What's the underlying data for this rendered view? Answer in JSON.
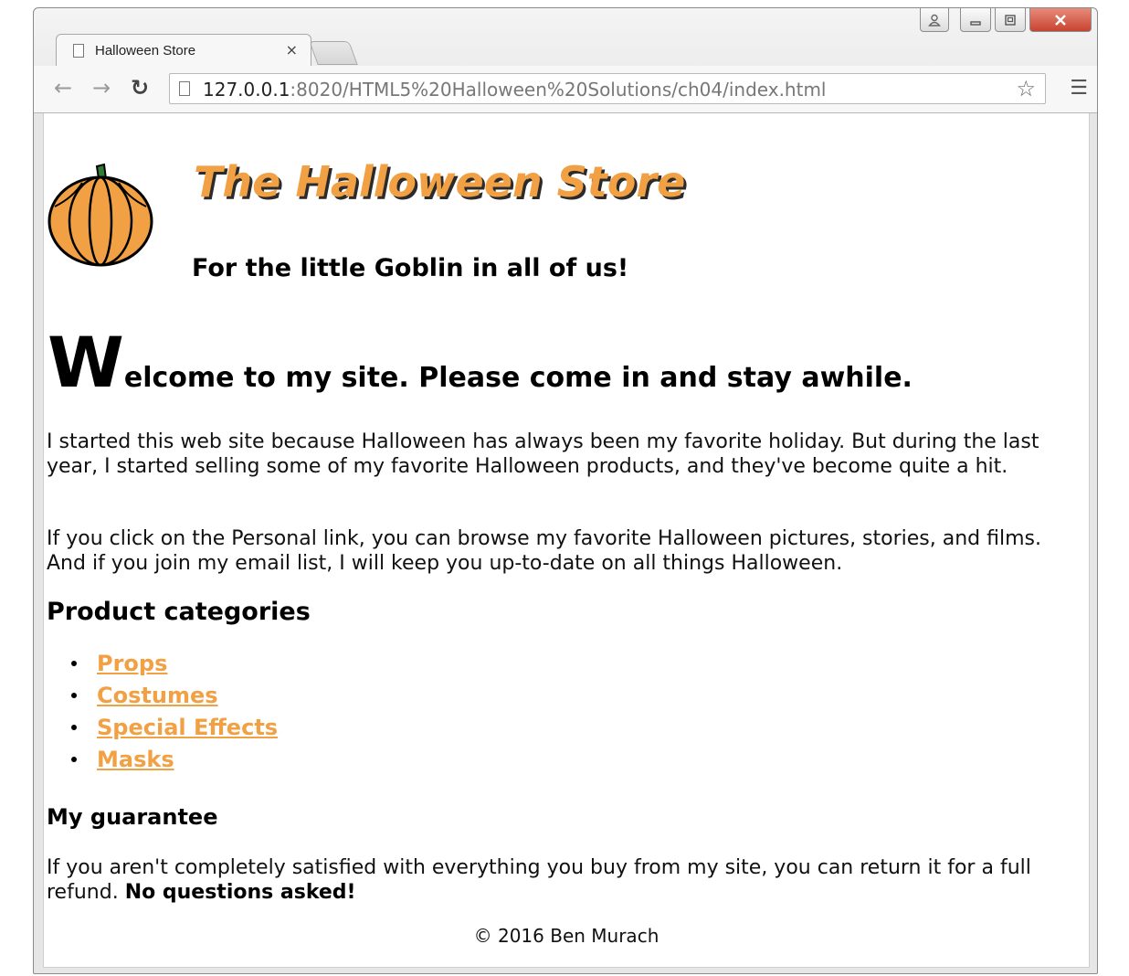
{
  "browser": {
    "tab_title": "Halloween Store",
    "tab_close": "×",
    "url_host": "127.0.0.1",
    "url_path": ":8020/HTML5%20Halloween%20Solutions/ch04/index.html",
    "icons": {
      "back": "back-arrow-icon",
      "forward": "forward-arrow-icon",
      "reload": "reload-icon",
      "bookmark": "star-icon",
      "menu": "hamburger-menu-icon",
      "profile": "profile-icon",
      "minimize": "minimize-icon",
      "maximize": "maximize-icon",
      "close": "close-icon"
    }
  },
  "page": {
    "store_title": "The Halloween Store",
    "tagline": "For the little Goblin in all of us!",
    "welcome_dropcap": "W",
    "welcome_rest": "elcome to my site. Please come in and stay awhile.",
    "intro_1": "I started this web site because Halloween has always been my favorite holiday. But during the last year, I started selling some of my favorite Halloween products, and they've become quite a hit.",
    "intro_2": "If you click on the Personal link, you can browse my favorite Halloween pictures, stories, and films. And if you join my email list, I will keep you up-to-date on all things Halloween.",
    "categories_heading": "Product categories",
    "categories": [
      {
        "label": "Props"
      },
      {
        "label": "Costumes"
      },
      {
        "label": "Special Effects"
      },
      {
        "label": "Masks"
      }
    ],
    "guarantee_heading": "My guarantee",
    "guarantee_text": "If you aren't completely satisfied with everything you buy from my site, you can return it for a full refund.",
    "guarantee_bold": "No questions asked!",
    "footer": "© 2016 Ben Murach"
  },
  "colors": {
    "accent_orange": "#f2a044",
    "text": "#111111",
    "close_button": "#c7442f"
  }
}
